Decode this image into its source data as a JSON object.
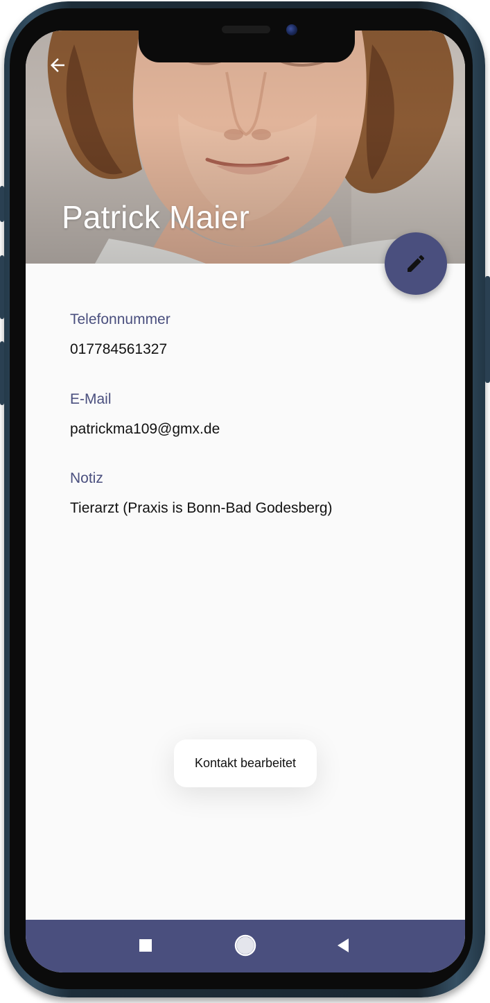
{
  "contact": {
    "name": "Patrick Maier"
  },
  "fields": [
    {
      "label": "Telefonnummer",
      "value": "017784561327"
    },
    {
      "label": "E-Mail",
      "value": "patrickma109@gmx.de"
    },
    {
      "label": "Notiz",
      "value": "Tierarzt (Praxis is Bonn-Bad Godesberg)"
    }
  ],
  "snackbar": {
    "message": "Kontakt bearbeitet"
  },
  "icons": {
    "back": "arrow-left-icon",
    "edit": "pencil-icon",
    "nav_recent": "square-icon",
    "nav_home": "circle-icon",
    "nav_back": "triangle-back-icon"
  },
  "colors": {
    "accent": "#4a4f7e",
    "label": "#4a4f7e",
    "text": "#111111",
    "background": "#fafafa",
    "name_text": "#ffffff"
  }
}
